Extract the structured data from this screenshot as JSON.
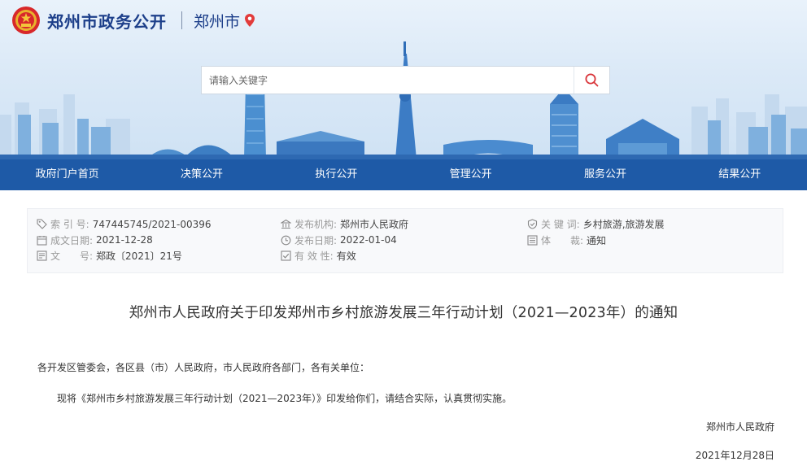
{
  "header": {
    "site_title": "郑州市政务公开",
    "city": "郑州市",
    "search": {
      "placeholder": "请输入关键字"
    }
  },
  "nav": {
    "items": [
      {
        "label": "政府门户首页"
      },
      {
        "label": "决策公开"
      },
      {
        "label": "执行公开"
      },
      {
        "label": "管理公开"
      },
      {
        "label": "服务公开"
      },
      {
        "label": "结果公开"
      }
    ]
  },
  "meta": {
    "index_no": {
      "label": "索 引 号:",
      "value": "747445745/2021-00396"
    },
    "created_date": {
      "label": "成文日期:",
      "value": "2021-12-28"
    },
    "doc_no": {
      "label": "文　　号:",
      "value": "郑政〔2021〕21号"
    },
    "issuer": {
      "label": "发布机构:",
      "value": "郑州市人民政府"
    },
    "publish_date": {
      "label": "发布日期:",
      "value": "2022-01-04"
    },
    "validity": {
      "label": "有 效 性:",
      "value": "有效"
    },
    "keywords": {
      "label": "关 键 词:",
      "value": "乡村旅游,旅游发展"
    },
    "genre": {
      "label": "体　　裁:",
      "value": "通知"
    }
  },
  "document": {
    "title": "郑州市人民政府关于印发郑州市乡村旅游发展三年行动计划（2021—2023年）的通知",
    "salutation": "各开发区管委会，各区县（市）人民政府，市人民政府各部门，各有关单位：",
    "body": "现将《郑州市乡村旅游发展三年行动计划（2021—2023年）》印发给你们，请结合实际，认真贯彻实施。",
    "signature": "郑州市人民政府",
    "date": "2021年12月28日"
  },
  "colors": {
    "nav_bg": "#1e5aa7",
    "title_blue": "#1d3f8a",
    "pin_red": "#e23b3b"
  }
}
